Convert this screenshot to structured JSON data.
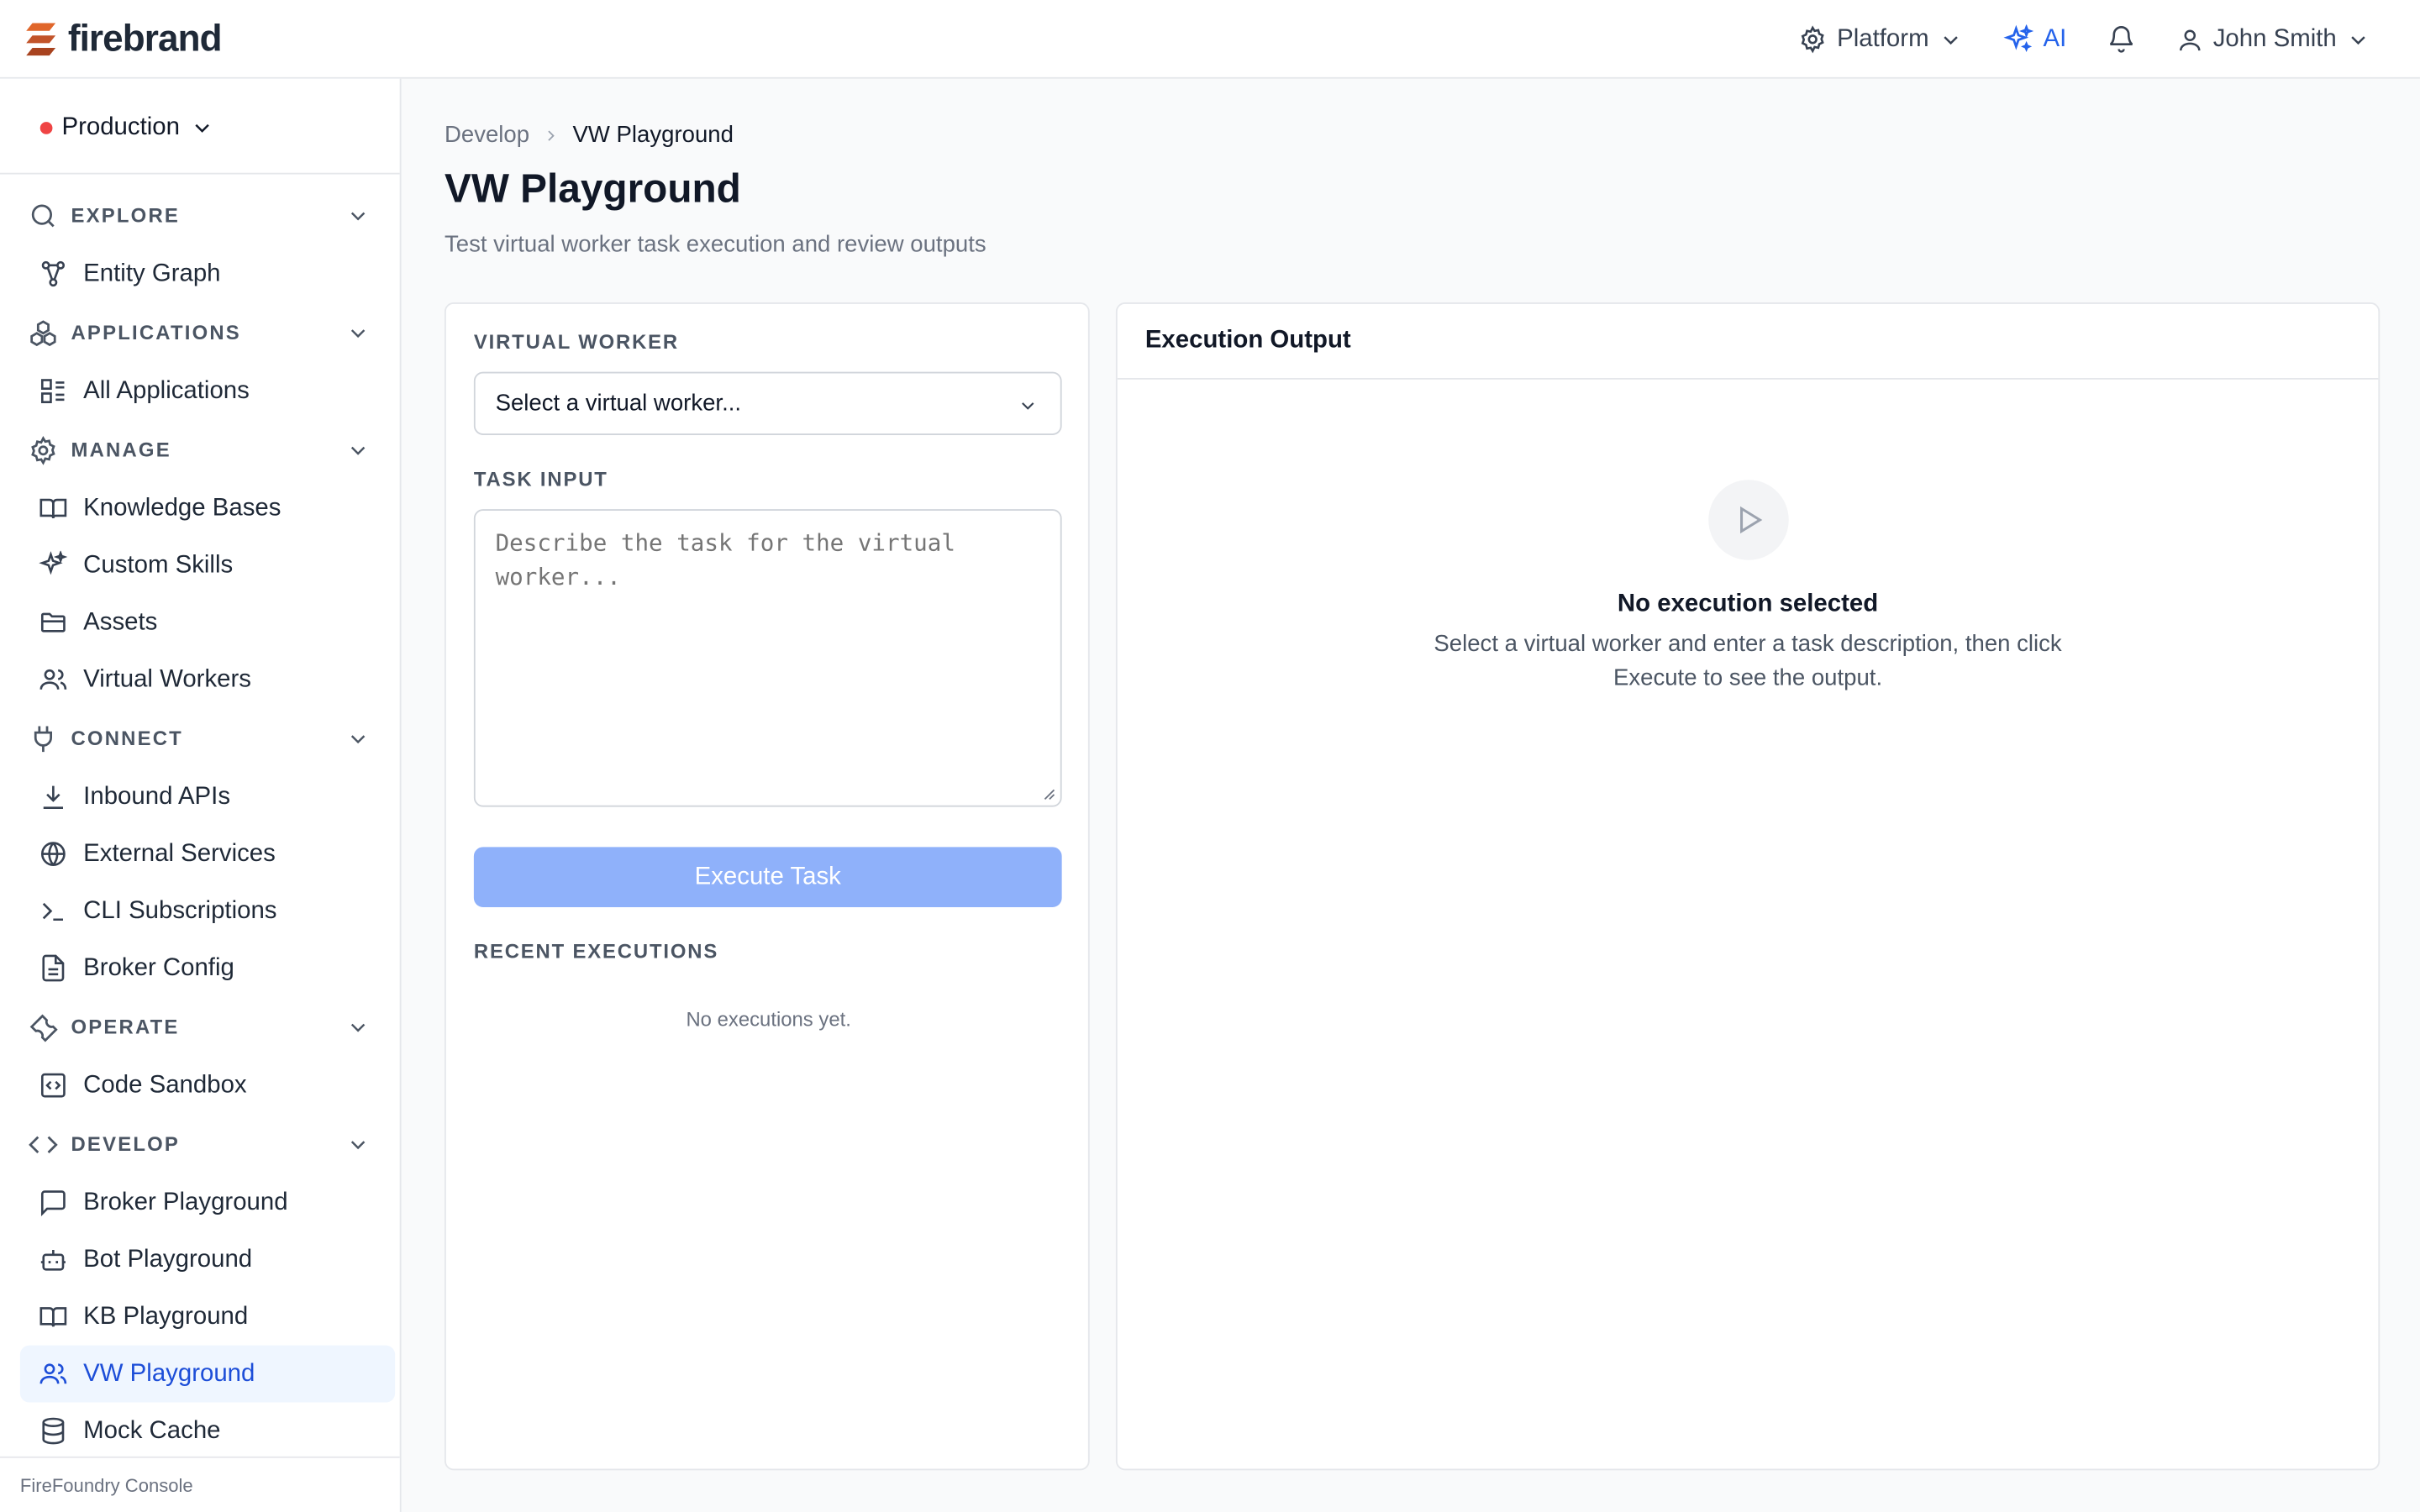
{
  "brand": {
    "name": "firebrand"
  },
  "topbar": {
    "platform_label": "Platform",
    "ai_label": "AI",
    "user_name": "John Smith"
  },
  "environment": {
    "label": "Production",
    "status_color": "#ef4444"
  },
  "sidebar": {
    "sections": {
      "explore": {
        "label": "EXPLORE",
        "items": [
          "Entity Graph"
        ]
      },
      "applications": {
        "label": "APPLICATIONS",
        "items": [
          "All Applications"
        ]
      },
      "manage": {
        "label": "MANAGE",
        "items": [
          "Knowledge Bases",
          "Custom Skills",
          "Assets",
          "Virtual Workers"
        ]
      },
      "connect": {
        "label": "CONNECT",
        "items": [
          "Inbound APIs",
          "External Services",
          "CLI Subscriptions",
          "Broker Config"
        ]
      },
      "operate": {
        "label": "OPERATE",
        "items": [
          "Code Sandbox"
        ]
      },
      "develop": {
        "label": "DEVELOP",
        "items": [
          "Broker Playground",
          "Bot Playground",
          "KB Playground",
          "VW Playground",
          "Mock Cache"
        ]
      }
    },
    "active_item": "VW Playground",
    "footer": "FireFoundry Console"
  },
  "breadcrumb": {
    "parent": "Develop",
    "current": "VW Playground"
  },
  "page": {
    "title": "VW Playground",
    "subtitle": "Test virtual worker task execution and review outputs"
  },
  "form": {
    "worker_label": "VIRTUAL WORKER",
    "worker_placeholder": "Select a virtual worker...",
    "task_label": "TASK INPUT",
    "task_placeholder": "Describe the task for the virtual worker...",
    "execute_label": "Execute Task",
    "recent_label": "RECENT EXECUTIONS",
    "recent_empty": "No executions yet."
  },
  "output": {
    "title": "Execution Output",
    "empty_title": "No execution selected",
    "empty_text": "Select a virtual worker and enter a task description, then click Execute to see the output."
  },
  "colors": {
    "accent": "#2563eb",
    "button_disabled": "#8fb1fa",
    "active_bg": "#eff6ff"
  }
}
